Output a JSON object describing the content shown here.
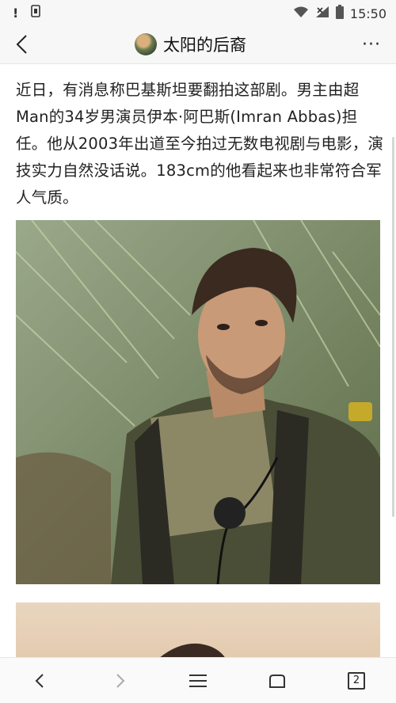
{
  "status_bar": {
    "left_icons": [
      "alert-icon",
      "sim-icon"
    ],
    "alert_text": "!",
    "right_icons": [
      "wifi-icon",
      "signal-icon",
      "battery-icon"
    ],
    "time": "15:50"
  },
  "header": {
    "title": "太阳的后裔",
    "back_icon": "chevron-left-icon",
    "more_icon": "more-icon",
    "more_label": "···"
  },
  "article": {
    "paragraph": "近日，有消息称巴基斯坦要翻拍这部剧。男主由超Man的34岁男演员伊本·阿巴斯(Imran Abbas)担任。他从2003年出道至今拍过无数电视剧与电影，演技实力自然没话说。183cm的他看起来也非常符合军人气质。"
  },
  "scroll_top": {
    "icon": "arrow-up-icon"
  },
  "bottom_nav": {
    "back_icon": "chevron-left-icon",
    "forward_icon": "chevron-right-icon",
    "menu_icon": "menu-icon",
    "home_icon": "home-icon",
    "tabs_count": "2"
  },
  "colors": {
    "bar_bg": "#f7f7f7",
    "text": "#222222",
    "grass": "#6e8159"
  }
}
